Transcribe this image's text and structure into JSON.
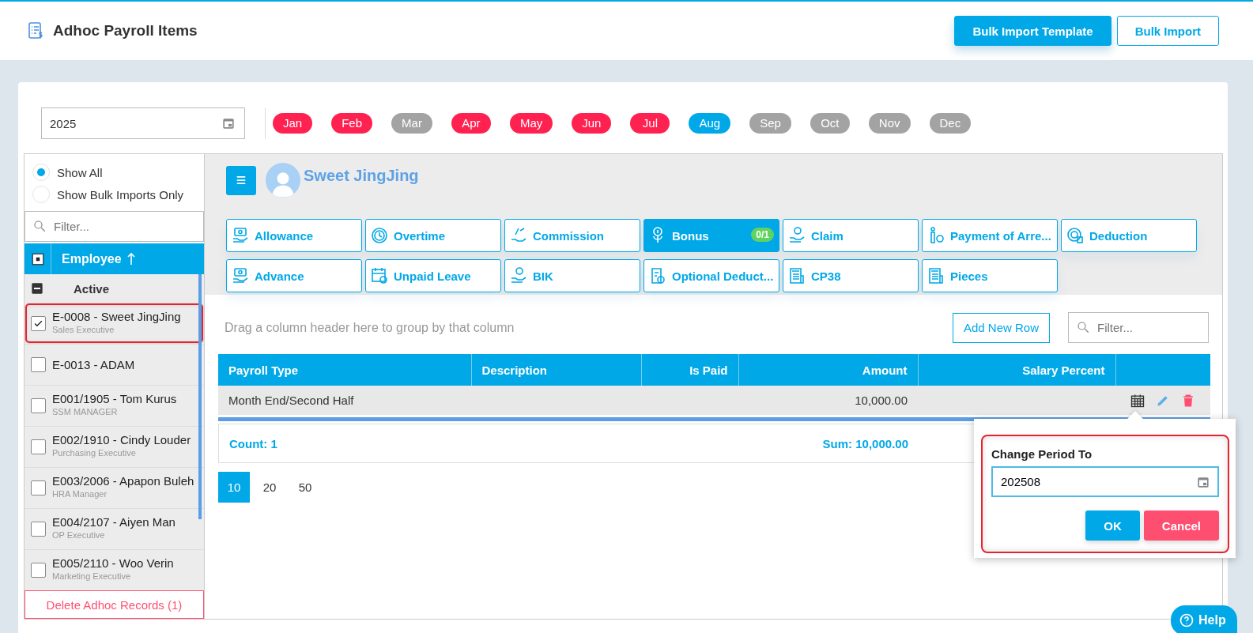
{
  "header": {
    "title": "Adhoc Payroll Items",
    "buttons": [
      {
        "label": "Bulk Import Template",
        "kind": "primary"
      },
      {
        "label": "Bulk Import",
        "kind": "outline"
      }
    ]
  },
  "year_field": {
    "value": "2025"
  },
  "months": [
    {
      "label": "Jan",
      "selected": false,
      "has_records": true
    },
    {
      "label": "Feb",
      "selected": false,
      "has_records": true
    },
    {
      "label": "Mar",
      "selected": false,
      "has_records": false
    },
    {
      "label": "Apr",
      "selected": false,
      "has_records": true
    },
    {
      "label": "May",
      "selected": false,
      "has_records": true
    },
    {
      "label": "Jun",
      "selected": false,
      "has_records": true
    },
    {
      "label": "Jul",
      "selected": false,
      "has_records": true
    },
    {
      "label": "Aug",
      "selected": true,
      "has_records": false
    },
    {
      "label": "Sep",
      "selected": false,
      "has_records": false
    },
    {
      "label": "Oct",
      "selected": false,
      "has_records": false
    },
    {
      "label": "Nov",
      "selected": false,
      "has_records": false
    },
    {
      "label": "Dec",
      "selected": false,
      "has_records": false
    }
  ],
  "sidebar": {
    "filters": [
      {
        "label": "Show All",
        "selected": true
      },
      {
        "label": "Show Bulk Imports Only",
        "selected": false
      }
    ],
    "search": {
      "placeholder": "Filter..."
    },
    "header": {
      "label": "Employee",
      "sorted_ascending": true,
      "partially_selected": true
    },
    "group": {
      "label": "Active",
      "expanded": true
    },
    "employees": [
      {
        "name": "E-0008 - Sweet JingJing",
        "role": "Sales Executive",
        "checked": true,
        "highlighted": true
      },
      {
        "name": "E-0013 - ADAM",
        "checked": false,
        "highlighted": false
      },
      {
        "name": "E001/1905 - Tom Kurus",
        "role": "SSM MANAGER",
        "checked": false,
        "highlighted": false
      },
      {
        "name": "E002/1910 - Cindy Louder",
        "role": "Purchasing Executive",
        "checked": false,
        "highlighted": false
      },
      {
        "name": "E003/2006 - Apapon Buleh",
        "role": "HRA Manager",
        "checked": false,
        "highlighted": false
      },
      {
        "name": "E004/2107 - Aiyen Man",
        "role": "OP Executive",
        "checked": false,
        "highlighted": false
      },
      {
        "name": "E005/2110 - Woo Verin",
        "role": "Marketing Executive",
        "checked": false,
        "highlighted": false
      }
    ],
    "delete_button": "Delete Adhoc Records (1)"
  },
  "employee_name": "Sweet JingJing",
  "categories": [
    {
      "label": "Allowance",
      "selected": false
    },
    {
      "label": "Overtime",
      "selected": false
    },
    {
      "label": "Commission",
      "selected": false
    },
    {
      "label": "Bonus",
      "selected": true,
      "badge": "0/1"
    },
    {
      "label": "Claim",
      "selected": false
    },
    {
      "label": "Payment of Arre...",
      "selected": false
    },
    {
      "label": "Deduction",
      "selected": false
    },
    {
      "label": "Advance",
      "selected": false
    },
    {
      "label": "Unpaid Leave",
      "selected": false
    },
    {
      "label": "BIK",
      "selected": false
    },
    {
      "label": "Optional Deduct...",
      "selected": false
    },
    {
      "label": "CP38",
      "selected": false
    },
    {
      "label": "Pieces",
      "selected": false
    }
  ],
  "grid": {
    "group_hint": "Drag a column header here to group by that column",
    "add_button": "Add New Row",
    "search": {
      "placeholder": "Filter..."
    },
    "columns": [
      {
        "label": "Payroll Type",
        "align_right": false
      },
      {
        "label": "Description",
        "align_right": false
      },
      {
        "label": "Is Paid",
        "align_right": true
      },
      {
        "label": "Amount",
        "align_right": true
      },
      {
        "label": "Salary Percent",
        "align_right": true
      }
    ],
    "rows": [
      {
        "cells": [
          "Month End/Second Half",
          "",
          "",
          "10,000.00",
          ""
        ]
      }
    ],
    "footer": {
      "count": "Count: 1",
      "sum": "Sum: 10,000.00"
    },
    "page_sizes": [
      {
        "label": "10",
        "selected": true
      },
      {
        "label": "20",
        "selected": false
      },
      {
        "label": "50",
        "selected": false
      }
    ]
  },
  "popup": {
    "title": "Change Period To",
    "value": "202508",
    "highlighted": true,
    "buttons": [
      {
        "label": "OK",
        "kind": "ok"
      },
      {
        "label": "Cancel",
        "kind": "cancel"
      }
    ]
  },
  "help_button": "Help"
}
